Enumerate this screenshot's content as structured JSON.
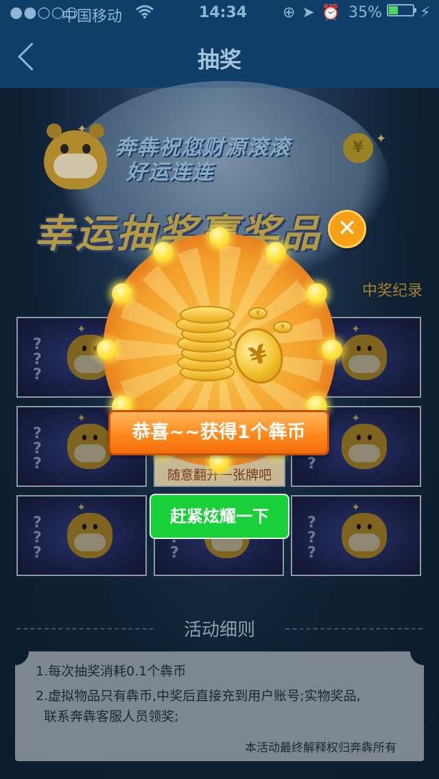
{
  "status_bar": {
    "signal": "●●○○○",
    "carrier": "中国移动",
    "wifi_icon": "wifi-icon",
    "time": "14:34",
    "icons": "⊕➤⏰",
    "battery_text": "35%",
    "battery_level": 0.35,
    "charging_icon": "⚡"
  },
  "nav": {
    "back_icon": "chevron-left-icon",
    "title": "抽奖"
  },
  "banner": {
    "slogan_line1": "奔犇祝您财源滚滚",
    "slogan_line2": "好运连连",
    "headline": "幸运抽奖赢奖品",
    "coin_symbol": "¥"
  },
  "record_link": "中奖纪录",
  "grid": {
    "question_marks": "?\n?\n?",
    "center_label": "随意翻开一张牌吧"
  },
  "popup": {
    "congrats": "恭喜~~获得1个犇币",
    "close_symbol": "✕",
    "share_button": "赶紧炫耀一下",
    "coin_symbol": "¥",
    "accent_color": "#ff8a1c",
    "share_color": "#19d03a"
  },
  "rules": {
    "title": "活动细则",
    "items": [
      "1.每次抽奖消耗0.1个犇币",
      "2.虚拟物品只有犇币,中奖后直接充到用户账号;实物奖品,",
      "  联系奔犇客服人员领奖;"
    ],
    "footer": "本活动最终解释权归奔犇所有"
  }
}
